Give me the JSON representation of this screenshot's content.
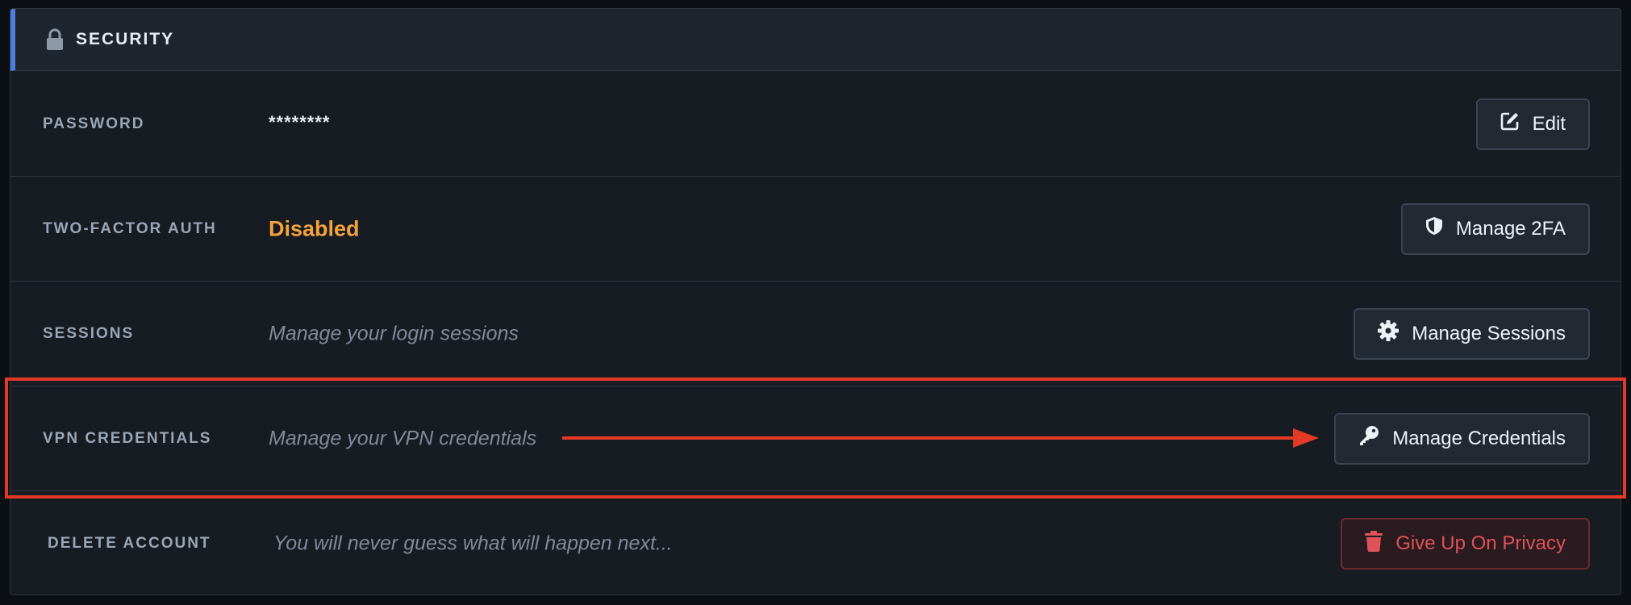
{
  "header": {
    "title": "SECURITY",
    "icon": "lock-icon"
  },
  "rows": [
    {
      "label": "PASSWORD",
      "value": "********",
      "button": "Edit",
      "icon": "edit-icon"
    },
    {
      "label": "TWO-FACTOR AUTH",
      "value": "Disabled",
      "button": "Manage 2FA",
      "icon": "shield-icon"
    },
    {
      "label": "SESSIONS",
      "value": "Manage your login sessions",
      "button": "Manage Sessions",
      "icon": "gear-icon"
    },
    {
      "label": "VPN CREDENTIALS",
      "value": "Manage your VPN credentials",
      "button": "Manage Credentials",
      "icon": "key-icon"
    },
    {
      "label": "DELETE ACCOUNT",
      "value": "You will never guess what will happen next...",
      "button": "Give Up On Privacy",
      "icon": "trash-icon"
    }
  ],
  "colors": {
    "accent": "#4a7fe0",
    "warning": "#f2a33a",
    "danger": "#e0525a",
    "annotation": "#e23a26"
  }
}
